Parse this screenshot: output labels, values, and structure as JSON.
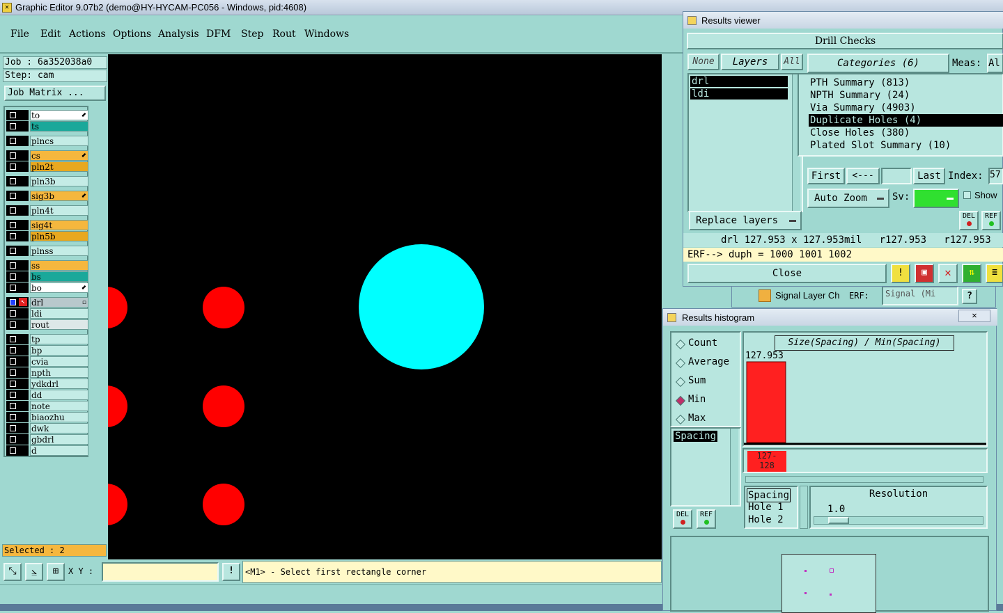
{
  "window": {
    "title": "Graphic Editor 9.07b2 (demo@HY-HYCAM-PC056 - Windows, pid:4608)"
  },
  "menu": [
    "File",
    "Edit",
    "Actions",
    "Options",
    "Analysis",
    "DFM",
    "Step",
    "Rout",
    "Windows"
  ],
  "job": {
    "job_label": "Job : 6a352038a0",
    "step_label": "Step: cam",
    "matrix_button": "Job Matrix ..."
  },
  "layers": [
    {
      "name": "to",
      "color": "#ffffff",
      "mark": "⬋"
    },
    {
      "name": "ts",
      "color": "#1aa89a",
      "mark": ""
    },
    {
      "name": "plncs",
      "color": "#c4ece6",
      "mark": ""
    },
    {
      "name": "cs",
      "color": "#f5b73e",
      "mark": "⬋"
    },
    {
      "name": "pln2t",
      "color": "#e8a820",
      "mark": ""
    },
    {
      "name": "pln3b",
      "color": "#c4ece6",
      "mark": ""
    },
    {
      "name": "sig3b",
      "color": "#f5b73e",
      "mark": "⬋"
    },
    {
      "name": "pln4t",
      "color": "#c4ece6",
      "mark": ""
    },
    {
      "name": "sig4t",
      "color": "#f5b73e",
      "mark": ""
    },
    {
      "name": "pln5b",
      "color": "#e8a820",
      "mark": ""
    },
    {
      "name": "plnss",
      "color": "#c4ece6",
      "mark": ""
    },
    {
      "name": "ss",
      "color": "#f5b73e",
      "mark": ""
    },
    {
      "name": "bs",
      "color": "#1aa89a",
      "mark": ""
    },
    {
      "name": "bo",
      "color": "#ffffff",
      "mark": "⬋"
    },
    {
      "name": "drl",
      "color": "#b8c8cc",
      "mark": "▫"
    },
    {
      "name": "ldi",
      "color": "#c4ece6",
      "mark": ""
    },
    {
      "name": "rout",
      "color": "#dde8e8",
      "mark": ""
    },
    {
      "name": "tp",
      "color": "#c4ece6",
      "mark": ""
    },
    {
      "name": "bp",
      "color": "#c4ece6",
      "mark": ""
    },
    {
      "name": "cvia",
      "color": "#c4ece6",
      "mark": ""
    },
    {
      "name": "npth",
      "color": "#c4ece6",
      "mark": ""
    },
    {
      "name": "ydkdrl",
      "color": "#c4ece6",
      "mark": ""
    },
    {
      "name": "dd",
      "color": "#c4ece6",
      "mark": ""
    },
    {
      "name": "note",
      "color": "#c4ece6",
      "mark": ""
    },
    {
      "name": "biaozhu",
      "color": "#c4ece6",
      "mark": ""
    },
    {
      "name": "dwk",
      "color": "#c4ece6",
      "mark": ""
    },
    {
      "name": "gbdrl",
      "color": "#c4ece6",
      "mark": ""
    },
    {
      "name": "d",
      "color": "#c4ece6",
      "mark": ""
    }
  ],
  "selected": "Selected : 2",
  "bottom": {
    "xy_label": "X Y :",
    "xy_value": "",
    "prompt": "<M1> - Select first rectangle corner",
    "bang": "!"
  },
  "results_viewer": {
    "title": "Results viewer",
    "header": "Drill Checks",
    "none_btn": "None",
    "layers_btn": "Layers",
    "all_btn": "All",
    "layer_items": [
      "drl",
      "ldi"
    ],
    "categories_btn": "Categories (6)",
    "meas_label": "Meas:",
    "meas_value": "Al",
    "categories": [
      "PTH Summary (813)",
      "NPTH Summary (24)",
      "Via Summary (4903)",
      "Duplicate Holes (4)",
      "Close Holes (380)",
      "Plated Slot Summary (10)"
    ],
    "first_btn": "First",
    "prev_btn": "<---",
    "nav_value": "",
    "last_btn": "Last",
    "index_label": "Index:",
    "index_value": "57",
    "auto_zoom": "Auto Zoom",
    "sv_label": "Sv:",
    "show_label": "Show",
    "replace_layers": "Replace layers",
    "del_label": "DEL",
    "ref_label": "REF",
    "measure_line": "drl 127.953 x 127.953mil   r127.953   r127.953",
    "erf_line": "ERF--> duph = 1000 1001 1002",
    "close_btn": "Close"
  },
  "background_window": {
    "label": "Signal Layer Ch",
    "erf_label": "ERF:",
    "erf_value": "Signal (Mi",
    "help": "?"
  },
  "histogram": {
    "title": "Results histogram",
    "modes": [
      {
        "label": "Count",
        "on": false
      },
      {
        "label": "Average",
        "on": false
      },
      {
        "label": "Sum",
        "on": false
      },
      {
        "label": "Min",
        "on": true
      },
      {
        "label": "Max",
        "on": false
      }
    ],
    "list_items": [
      "Spacing"
    ],
    "del_label": "DEL",
    "ref_label": "REF",
    "chart_title": "Size(Spacing) / Min(Spacing)",
    "bar_value": "127.953",
    "bar_label_top": "127-",
    "bar_label_bottom": "128",
    "detail_items": [
      "Spacing",
      "Hole 1",
      "Hole 2"
    ],
    "resolution_label": "Resolution",
    "resolution_value": "1.0"
  },
  "chart_data": {
    "type": "bar",
    "title": "Size(Spacing) / Min(Spacing)",
    "categories": [
      "127-128"
    ],
    "values": [
      127.953
    ],
    "xlabel": "",
    "ylabel": ""
  },
  "colors": {
    "bg": "#9fd8d0",
    "pad": "#ff0000",
    "flash": "#00ffff",
    "bar": "#ff2020"
  }
}
